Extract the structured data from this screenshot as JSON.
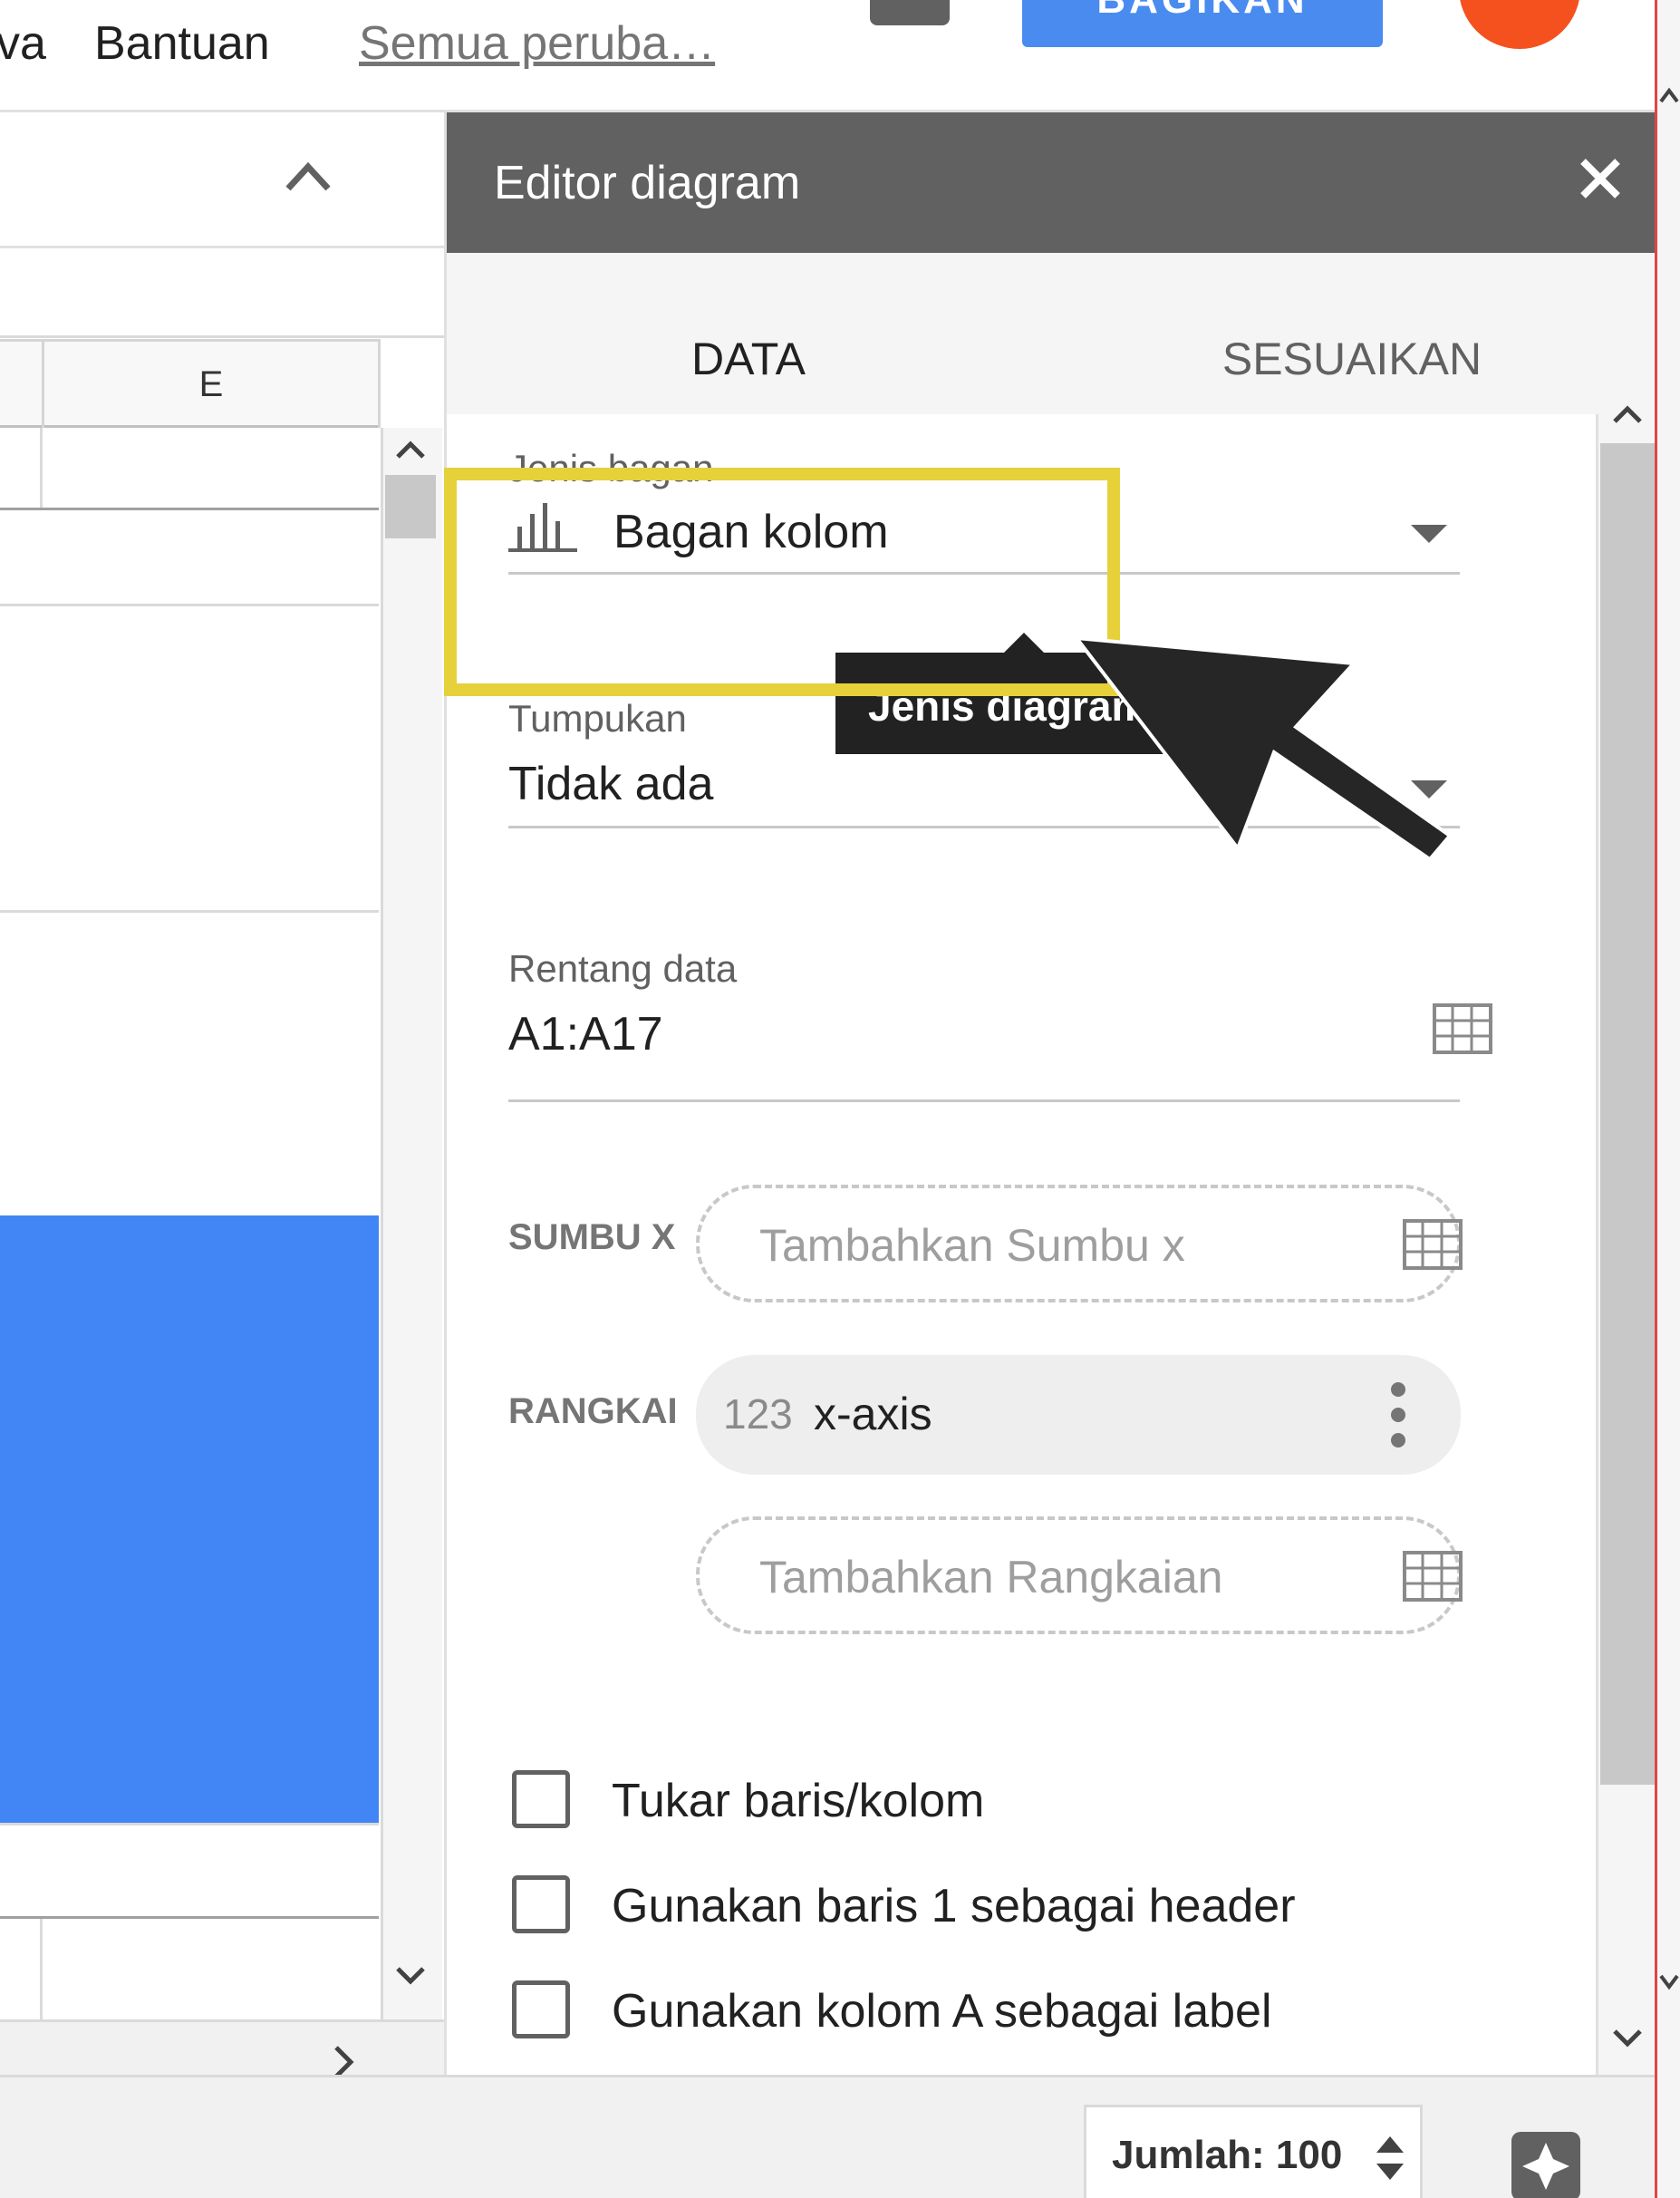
{
  "menu": {
    "partial_item": "va",
    "help_label": "Bantuan",
    "save_status": "Semua peruba…",
    "share_label": "BAGIKAN"
  },
  "sheet": {
    "column_header": "E"
  },
  "editor": {
    "title": "Editor diagram",
    "tabs": [
      {
        "label": "DATA",
        "active": true
      },
      {
        "label": "SESUAIKAN",
        "active": false
      }
    ],
    "chart_type": {
      "label": "Jenis bagan",
      "value": "Bagan kolom",
      "icon": "column-chart-icon",
      "tooltip": "Jenis diagram"
    },
    "stacking": {
      "label": "Tumpukan",
      "value": "Tidak ada"
    },
    "data_range": {
      "label": "Rentang data",
      "value": "A1:A17"
    },
    "x_axis": {
      "label": "SUMBU X",
      "placeholder": "Tambahkan Sumbu x"
    },
    "series": {
      "label": "RANGKAI",
      "type_badge": "123",
      "item": "x-axis",
      "add_placeholder": "Tambahkan Rangkaian"
    },
    "options": [
      {
        "label": "Tukar baris/kolom",
        "checked": false
      },
      {
        "label": "Gunakan baris 1 sebagai header",
        "checked": false
      },
      {
        "label": "Gunakan kolom A sebagai label",
        "checked": false
      }
    ]
  },
  "status": {
    "sum_text": "Jumlah: 100"
  },
  "colors": {
    "accent_blue": "#4285f4",
    "highlight_yellow": "#e6d13a",
    "header_gray": "#616161"
  }
}
